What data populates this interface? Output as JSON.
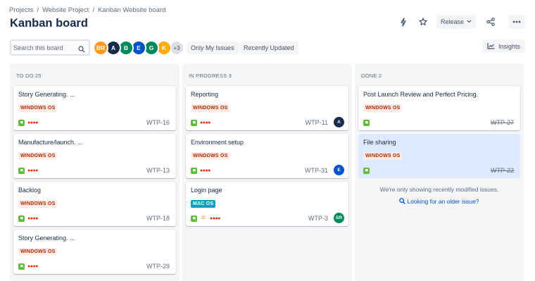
{
  "breadcrumb": {
    "items": [
      "Projects",
      "Website Project",
      "Kanban Website board"
    ],
    "sep": "/"
  },
  "page": {
    "title": "Kanban board"
  },
  "actions": {
    "release_label": "Release"
  },
  "search": {
    "placeholder": "Search this board"
  },
  "avatars": [
    {
      "initials": "BR",
      "color": "#ff991f"
    },
    {
      "initials": "A",
      "color": "#172b4d"
    },
    {
      "initials": "B",
      "color": "#00875a"
    },
    {
      "initials": "E",
      "color": "#0052cc"
    },
    {
      "initials": "G",
      "color": "#00875a"
    },
    {
      "initials": "K",
      "color": "#ffab00"
    }
  ],
  "avatars_more": "+3",
  "filters": {
    "my_issues": "Only My Issues",
    "recent": "Recently Updated"
  },
  "insights_label": "Insights",
  "columns": [
    {
      "title": "TO DO 25",
      "cards": [
        {
          "title": "Story Generating. ...",
          "label": "WINDOWS OS",
          "key": "WTP-16"
        },
        {
          "title": "Manufacture/launch. ...",
          "label": "WINDOWS OS",
          "key": "WTP-13"
        },
        {
          "title": "Backlog",
          "label": "WINDOWS OS",
          "key": "WTP-18"
        },
        {
          "title": "Story Generating. ...",
          "label": "WINDOWS OS",
          "key": "WTP-29"
        }
      ]
    },
    {
      "title": "IN PROGRESS 3",
      "cards": [
        {
          "title": "Reporting",
          "label": "WINDOWS OS",
          "key": "WTP-11",
          "assignee": "A"
        },
        {
          "title": "Environment setup",
          "label": "WINDOWS OS",
          "key": "WTP-31",
          "assignee": "E"
        },
        {
          "title": "Login page",
          "label": "MAC OS",
          "key": "WTP-3",
          "assignee": "SR"
        }
      ]
    },
    {
      "title": "DONE 2",
      "cards": [
        {
          "title": "Post Launch Review and Perfect Pricing.",
          "label": "WINDOWS OS",
          "key": "WTP-27"
        },
        {
          "title": "File sharing",
          "label": "WINDOWS OS",
          "key": "WTP-22"
        }
      ]
    }
  ],
  "done_note": "We're only showing recently modified issues.",
  "done_link": "Looking for an older issue?",
  "priority_marks": {
    "high": "●●●●",
    "medium": "="
  },
  "colors": {
    "blue": "#0052cc",
    "story_green": "#63ba3c",
    "priority_red": "#de350b"
  }
}
